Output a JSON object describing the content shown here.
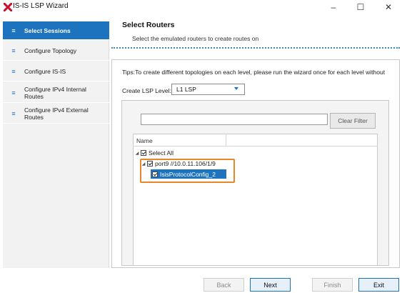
{
  "window": {
    "title": "IS-IS LSP Wizard",
    "minimize": "–",
    "maximize": "☐",
    "close": "✕"
  },
  "sidebar": {
    "items": [
      {
        "label": "Select Sessions",
        "icon": "≡"
      },
      {
        "label": "Configure Topology",
        "icon": "≡"
      },
      {
        "label": "Configure IS-IS",
        "icon": "≡"
      },
      {
        "label": "Configure IPv4 Internal Routes",
        "icon": "≡"
      },
      {
        "label": "Configure IPv4 External Routes",
        "icon": "≡"
      }
    ]
  },
  "main": {
    "title": "Select Routers",
    "subtitle": "Select the emulated routers to create routes on",
    "tips": "Tips:To create different topologies on each level, please run the wizard once for each level without",
    "level_label": "Create LSP Level:",
    "level_value": "L1 LSP",
    "filter_placeholder": "",
    "clear_filter": "Clear Filter",
    "tree": {
      "column_name": "Name",
      "select_all": "Select All",
      "port": "port9 //10.0.11.106/1/9",
      "protocol": "IsisProtocolConfig_2"
    }
  },
  "footer": {
    "back": "Back",
    "next": "Next",
    "finish": "Finish",
    "exit": "Exit"
  },
  "colors": {
    "accent": "#1e73be",
    "highlight": "#e8862a",
    "logo": "#c8102e"
  }
}
